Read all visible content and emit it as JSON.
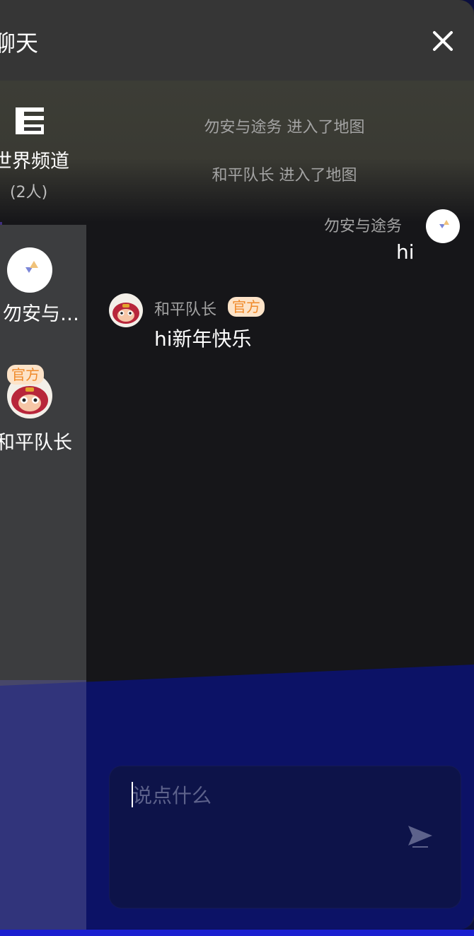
{
  "header": {
    "title": "聊天",
    "close_icon": "close-icon"
  },
  "notices": [
    "勿安与途务 进入了地图",
    "和平队长 进入了地图"
  ],
  "sidebar": {
    "channel": {
      "label": "世界频道",
      "count": "(2人)",
      "icon": "channel-icon"
    },
    "members": [
      {
        "name": "勿安与…",
        "avatar": "triangle-avatar",
        "badge": ""
      },
      {
        "name": "和平队长",
        "avatar": "lion-avatar",
        "badge": "官方"
      }
    ]
  },
  "messages": [
    {
      "sender": "勿安与途务",
      "text": "hi",
      "side": "right",
      "badge": ""
    },
    {
      "sender": "和平队长",
      "text": "hi新年快乐",
      "side": "left",
      "badge": "官方"
    }
  ],
  "composer": {
    "placeholder": "说点什么",
    "send_icon": "send-icon"
  },
  "colors": {
    "badge_bg": "#fde3c8",
    "badge_text": "#f08a2a",
    "composer_bg": "#0c1266"
  }
}
